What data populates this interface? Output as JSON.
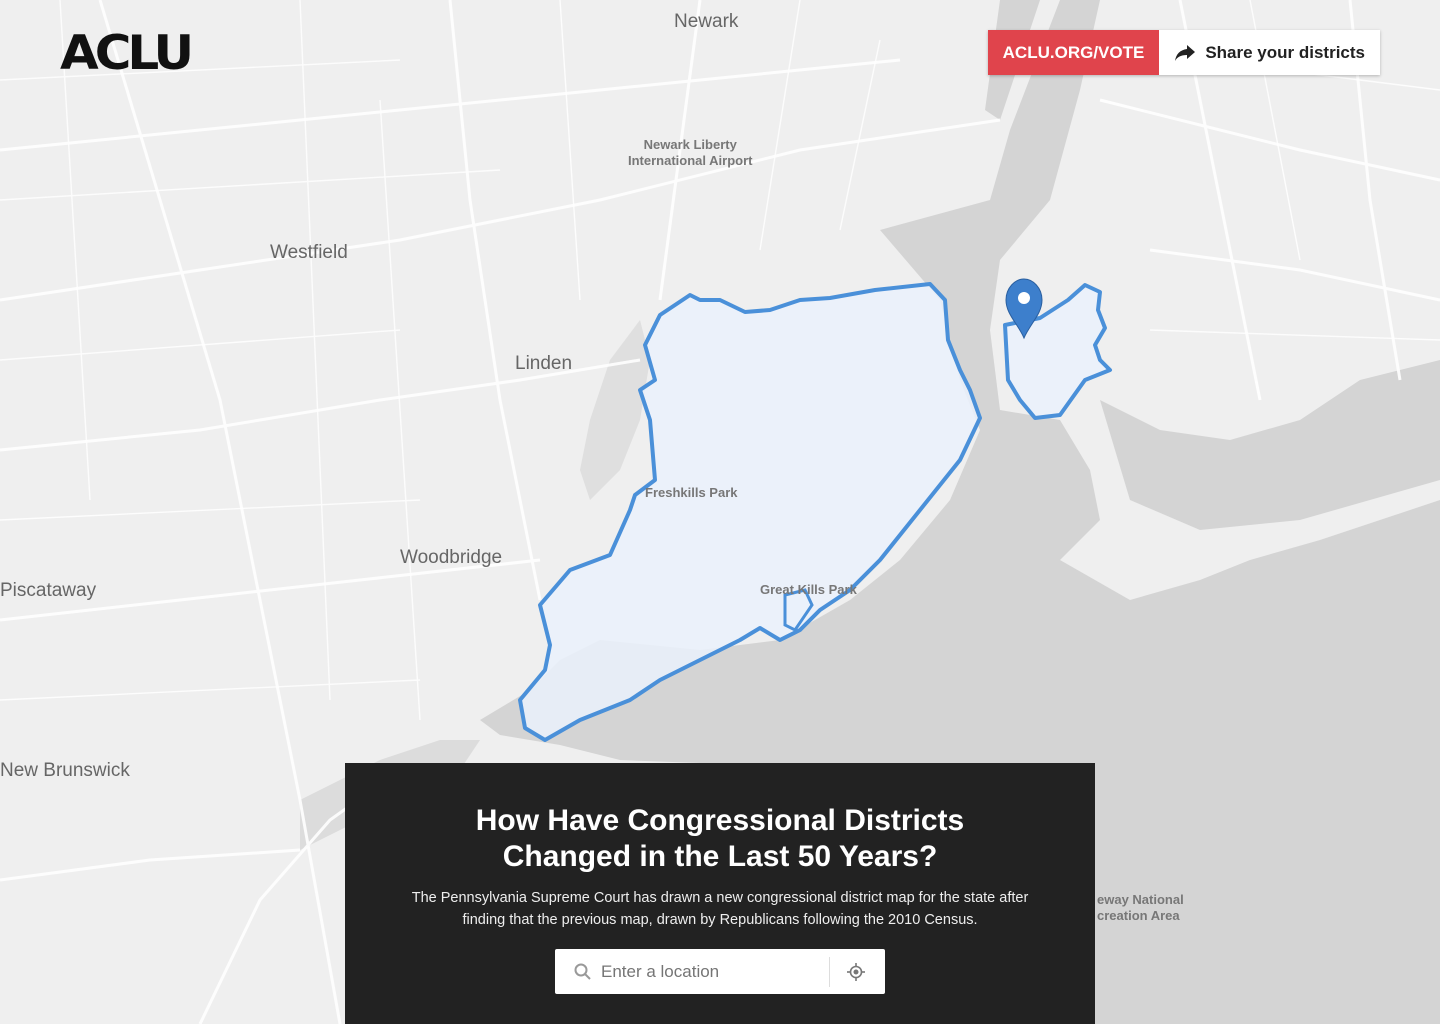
{
  "header": {
    "logo_text": "ACLU",
    "vote_link": "ACLU.ORG/VOTE",
    "share_label": "Share your districts",
    "accent_color": "#e0444c"
  },
  "map": {
    "places": {
      "newark": "Newark",
      "airport_line1": "Newark Liberty",
      "airport_line2": "International Airport",
      "westfield": "Westfield",
      "linden": "Linden",
      "woodbridge": "Woodbridge",
      "piscataway": "Piscataway",
      "new_brunswick": "New Brunswick",
      "freshkills": "Freshkills Park",
      "great_kills": "Great Kills Park",
      "gateway_line1": "eway National",
      "gateway_line2": "creation Area"
    },
    "district_outline_color": "#4a90d9",
    "district_fill_color": "#eaf1fb",
    "water_color": "#d4d4d4",
    "land_color": "#efefef",
    "marker_icon": "map-pin-icon"
  },
  "panel": {
    "title_line1": "How Have Congressional Districts",
    "title_line2": "Changed in the Last 50 Years?",
    "description": "The Pennsylvania Supreme Court has drawn a new congressional district map for the state after finding that the previous map, drawn by Republicans following the 2010 Census.",
    "search_placeholder": "Enter a location",
    "search_icon": "search-icon",
    "locate_icon": "locate-icon"
  }
}
